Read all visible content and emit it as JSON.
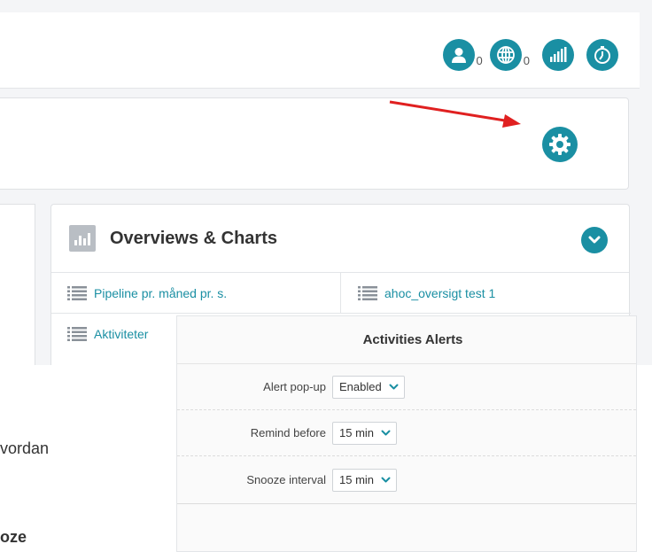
{
  "header": {
    "users_count": "0",
    "web_count": "0"
  },
  "overviews": {
    "title": "Overviews & Charts",
    "items": [
      "Pipeline pr. måned pr. s.",
      "ahoc_oversigt test 1",
      "Aktiviteter"
    ]
  },
  "background_text": {
    "line1": "vordan",
    "line2": "oze"
  },
  "alerts": {
    "title": "Activities Alerts",
    "rows": [
      {
        "label": "Alert pop-up",
        "value": "Enabled"
      },
      {
        "label": "Remind before",
        "value": "15 min"
      },
      {
        "label": "Snooze interval",
        "value": "15 min"
      }
    ]
  },
  "colors": {
    "accent": "#1a8fa3",
    "arrow": "#e02020",
    "badge": "#b9bec4"
  }
}
